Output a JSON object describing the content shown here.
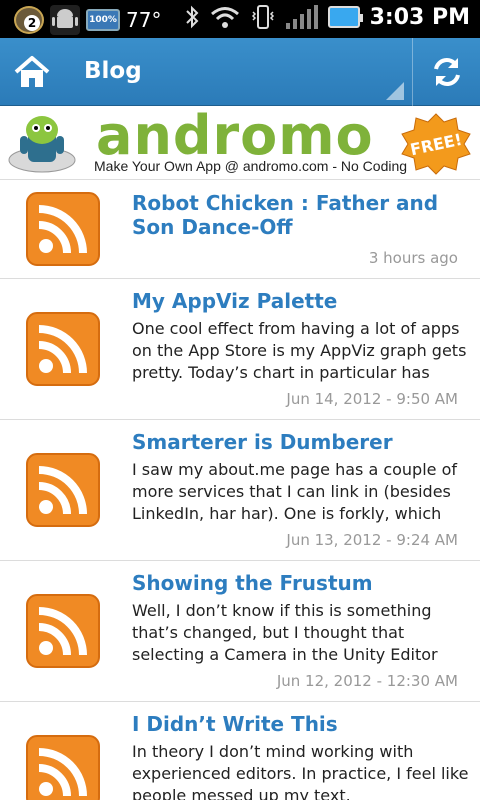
{
  "statusbar": {
    "notification_count": "2",
    "battery_small_label": "100%",
    "temperature": "77°",
    "time": "3:03 PM"
  },
  "actionbar": {
    "title": "Blog"
  },
  "banner": {
    "brand": "andromo",
    "tagline": "Make Your Own App @ andromo.com - No Coding",
    "badge": "FREE!"
  },
  "posts": [
    {
      "title": "Robot Chicken : Father and Son Dance-Off",
      "excerpt": "",
      "date": "3 hours ago"
    },
    {
      "title": "My AppViz Palette",
      "excerpt": "One cool effect from having a lot of apps on the App Store is my AppViz graph gets pretty. Today’s chart in particular has",
      "date": "Jun 14, 2012 - 9:50 AM"
    },
    {
      "title": "Smarterer is Dumberer",
      "excerpt": "I saw my about.me page has a couple of more services that I can link in (besides LinkedIn, har har). One is forkly, which",
      "date": "Jun 13, 2012 - 9:24 AM"
    },
    {
      "title": "Showing the Frustum",
      "excerpt": "Well, I don’t know if this is something that’s changed, but I thought that selecting a Camera in the Unity Editor",
      "date": "Jun 12, 2012 - 12:30 AM"
    },
    {
      "title": "I Didn’t Write This",
      "excerpt": "In theory I don’t mind working with experienced editors. In practice, I feel like people messed up my text.",
      "date": ""
    }
  ],
  "colors": {
    "actionbar": "#2b7bb8",
    "title_link": "#2d7dbf",
    "rss_orange": "#f08a24"
  }
}
